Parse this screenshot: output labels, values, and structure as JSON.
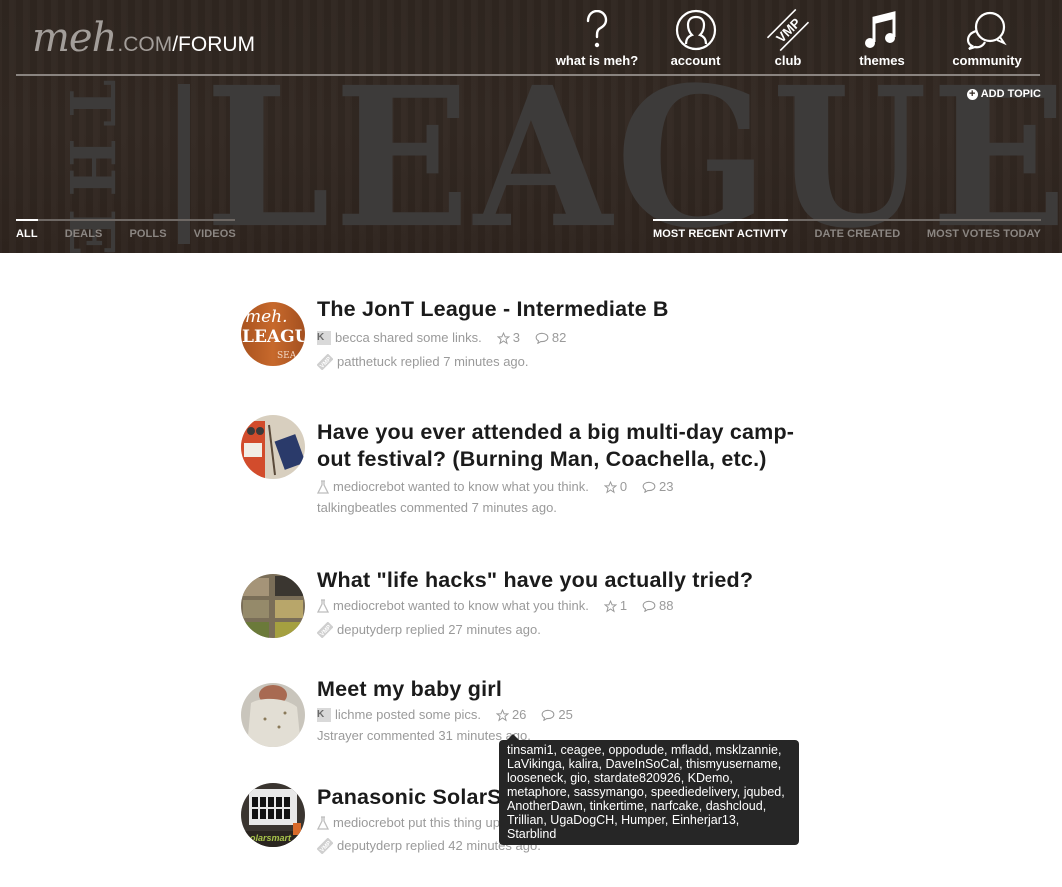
{
  "header": {
    "logo_meh": "meh",
    "logo_com": ".COM",
    "logo_forum": "/FORUM",
    "banner_text": "LEAGUE",
    "banner_side_text": "THE",
    "nav": [
      {
        "label": "what is meh?",
        "icon": "question-icon"
      },
      {
        "label": "account",
        "icon": "account-icon"
      },
      {
        "label": "club",
        "icon": "vmp-club-icon"
      },
      {
        "label": "themes",
        "icon": "music-note-icon"
      },
      {
        "label": "community",
        "icon": "chat-bubbles-icon"
      }
    ],
    "add_topic": "ADD TOPIC",
    "filter_tabs": [
      {
        "label": "ALL",
        "active": true
      },
      {
        "label": "DEALS",
        "active": false
      },
      {
        "label": "POLLS",
        "active": false
      },
      {
        "label": "VIDEOS",
        "active": false
      }
    ],
    "sort_tabs": [
      {
        "label": "MOST RECENT ACTIVITY",
        "active": true
      },
      {
        "label": "DATE CREATED",
        "active": false
      },
      {
        "label": "MOST VOTES TODAY",
        "active": false
      }
    ]
  },
  "topics": [
    {
      "title": "The JonT League - Intermediate B",
      "type_icon": "k-badge",
      "byline": "becca shared some links.",
      "stars": "3",
      "comments": "82",
      "activity_icon": "vmp-icon",
      "activity": "patthetuck replied 7 minutes ago."
    },
    {
      "title": "Have you ever attended a big multi-day camp-out festival? (Burning Man, Coachella, etc.)",
      "type_icon": "flask-icon",
      "byline": "mediocrebot wanted to know what you think.",
      "stars": "0",
      "comments": "23",
      "activity_icon": "",
      "activity": "talkingbeatles commented 7 minutes ago."
    },
    {
      "title": "What \"life hacks\" have you actually tried?",
      "type_icon": "flask-icon",
      "byline": "mediocrebot wanted to know what you think.",
      "stars": "1",
      "comments": "88",
      "activity_icon": "vmp-icon",
      "activity": "deputyderp replied 27 minutes ago."
    },
    {
      "title": "Meet my baby girl",
      "type_icon": "k-badge",
      "byline": "lichme posted some pics.",
      "stars": "26",
      "comments": "25",
      "activity_icon": "",
      "activity": "Jstrayer commented 31 minutes ago."
    },
    {
      "title": "Panasonic SolarSmart",
      "type_icon": "flask-icon",
      "byline": "mediocrebot put this thing up for sale.",
      "stars": "",
      "comments": "",
      "activity_icon": "vmp-icon",
      "activity": "deputyderp replied 42 minutes ago."
    }
  ],
  "kbadge_letter": "K",
  "tooltip": {
    "text": "tinsami1, ceagee, oppodude, mfladd, msklzannie, LaVikinga, kalira, DaveInSoCal, thismyusername, looseneck, gio, stardate820926, KDemo, metaphore, sassymango, speediedelivery, jqubed, AnotherDawn, tinkertime, narfcake, dashcloud, Trillian, UgaDogCH, Humper, Einherjar13, Starblind"
  },
  "colors": {
    "header_bg": "#2f2620",
    "active_tab": "#ffffff",
    "inactive_tab": "#8b8682",
    "meta_text": "#9a9a9a",
    "title_text": "#1b1b1b",
    "tooltip_bg": "#262626"
  }
}
